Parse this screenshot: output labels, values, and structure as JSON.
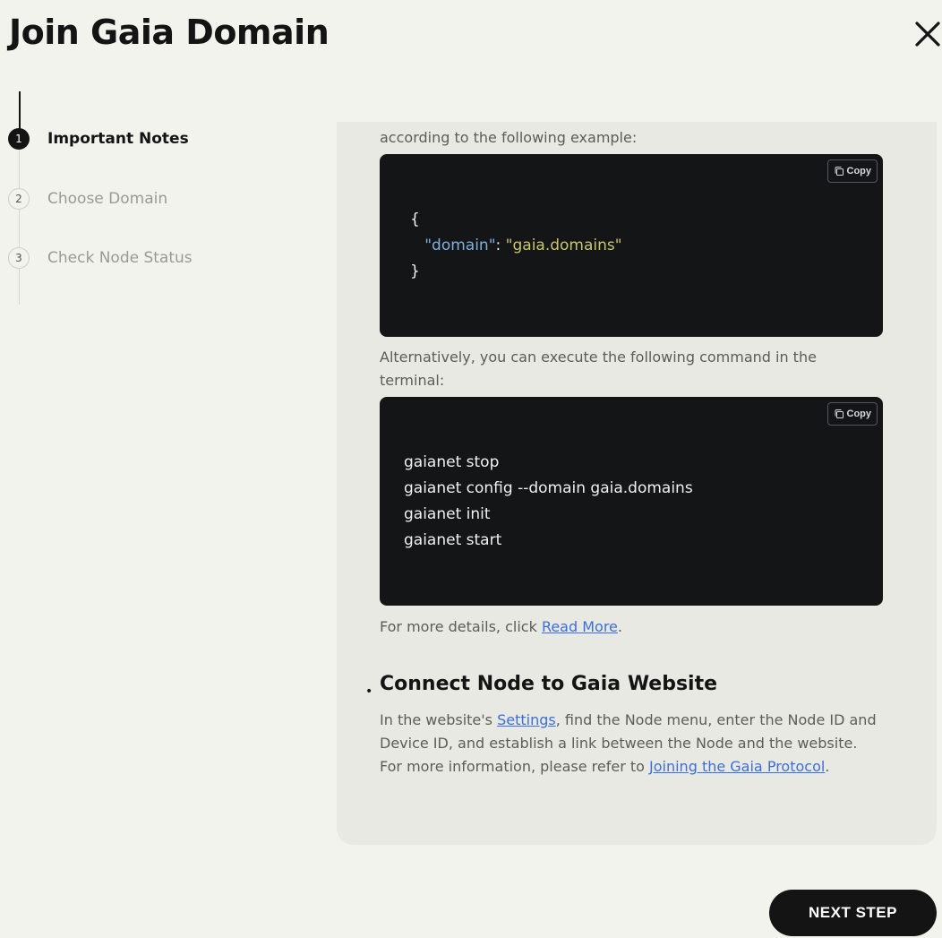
{
  "dialog": {
    "title": "Join Gaia Domain",
    "close_icon": "close-icon"
  },
  "stepper": {
    "steps": [
      {
        "number": "1",
        "label": "Important Notes",
        "state": "active"
      },
      {
        "number": "2",
        "label": "Choose Domain",
        "state": "inactive"
      },
      {
        "number": "3",
        "label": "Check Node Status",
        "state": "inactive"
      }
    ]
  },
  "content": {
    "intro_tail": "according to the following example:",
    "json_example": {
      "copy_label": "Copy",
      "open_brace": "{",
      "key": "\"domain\"",
      "colon": ": ",
      "value": "\"gaia.domains\"",
      "close_brace": "}"
    },
    "alt_text": "Alternatively, you can execute the following command in the terminal:",
    "command_block": {
      "copy_label": "Copy",
      "lines": [
        "gaianet stop",
        "gaianet config --domain gaia.domains",
        "gaianet init",
        "gaianet start"
      ]
    },
    "more_details": {
      "prefix": "For more details, click ",
      "link": "Read More",
      "suffix": "."
    },
    "connect_section": {
      "heading": "Connect Node to Gaia Website",
      "text_1": "In the website's ",
      "link_settings": "Settings",
      "text_2": ", find the Node menu, enter the Node ID and Device ID, and establish a link between the Node and the website. For more information, please refer to ",
      "link_protocol": "Joining the Gaia Protocol",
      "text_3": "."
    }
  },
  "footer": {
    "next_label": "NEXT STEP"
  },
  "colors": {
    "background": "#f3f3ee",
    "panel": "#e9e9e4",
    "code_bg": "#141517",
    "link": "#3b6fd8",
    "json_key": "#7fb0e0",
    "json_value": "#c9c66a"
  }
}
